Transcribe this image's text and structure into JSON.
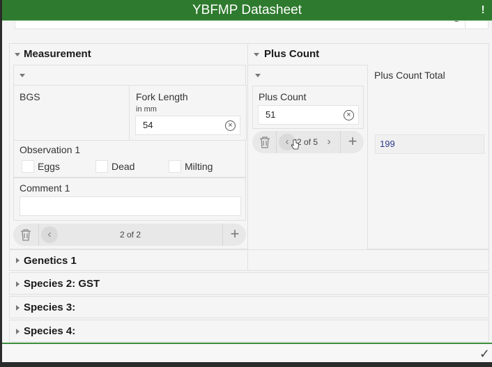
{
  "window": {
    "title": "YBFMP Datasheet",
    "alert_icon": "alert-icon"
  },
  "measurement": {
    "title": "Measurement",
    "species": "BGS",
    "fork_length": {
      "label": "Fork Length",
      "hint": "in mm",
      "value": "54"
    },
    "observation": {
      "label": "Observation 1",
      "options": [
        {
          "label": "Eggs",
          "checked": false
        },
        {
          "label": "Dead",
          "checked": false
        },
        {
          "label": "Milting",
          "checked": false
        }
      ]
    },
    "comment": {
      "label": "Comment 1",
      "value": ""
    },
    "pager": {
      "count": "2 of 2"
    }
  },
  "plus_count": {
    "title": "Plus Count",
    "field": {
      "label": "Plus Count",
      "value": "51"
    },
    "pager": {
      "count": "2 of 5"
    },
    "total": {
      "label": "Plus Count Total",
      "value": "199"
    }
  },
  "groups": [
    {
      "label": "Genetics 1"
    },
    {
      "label": "Species 2: GST"
    },
    {
      "label": "Species 3:"
    },
    {
      "label": "Species 4:"
    }
  ],
  "footer": {
    "submit_icon": "checkmark-icon"
  }
}
